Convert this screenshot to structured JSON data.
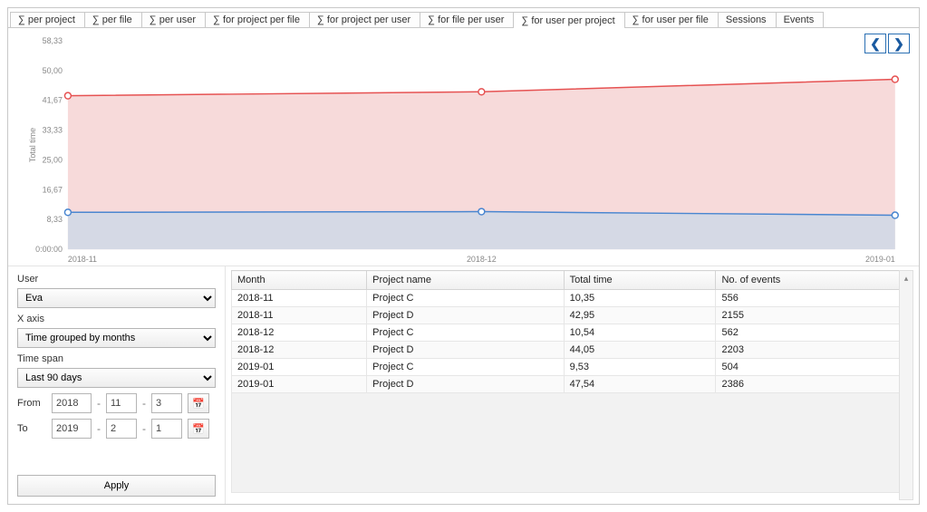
{
  "tabs": [
    "∑ per project",
    "∑ per file",
    "∑ per user",
    "∑ for project per file",
    "∑ for project per user",
    "∑ for file per user",
    "∑ for user per project",
    "∑ for user per file",
    "Sessions",
    "Events"
  ],
  "active_tab_index": 6,
  "chart_nav": {
    "prev": "❮",
    "next": "❯"
  },
  "chart_data": {
    "type": "area",
    "title": "",
    "xlabel": "",
    "ylabel": "Total time",
    "ylim": [
      0,
      58.33
    ],
    "yticks": [
      "0:00:00",
      "8,33",
      "16,67",
      "25,00",
      "33,33",
      "41,67",
      "50,00",
      "58,33"
    ],
    "x_categories": [
      "2018-11",
      "2018-12",
      "2019-01"
    ],
    "series": [
      {
        "name": "Project D",
        "color": "#e65252",
        "fill": "#f6d3d3",
        "values": [
          42.95,
          44.05,
          47.54
        ]
      },
      {
        "name": "Project C",
        "color": "#4a86d0",
        "fill": "#cfd8e6",
        "values": [
          10.35,
          10.54,
          9.53
        ]
      }
    ]
  },
  "filters": {
    "user_label": "User",
    "user_value": "Eva",
    "xaxis_label": "X axis",
    "xaxis_value": "Time grouped by months",
    "timespan_label": "Time span",
    "timespan_value": "Last 90 days",
    "from_label": "From",
    "to_label": "To",
    "from_date": {
      "y": "2018",
      "m": "11",
      "d": "3"
    },
    "to_date": {
      "y": "2019",
      "m": "2",
      "d": "1"
    },
    "apply_label": "Apply"
  },
  "table": {
    "columns": [
      "Month",
      "Project name",
      "Total time",
      "No. of events"
    ],
    "rows": [
      [
        "2018-11",
        "Project C",
        "10,35",
        "556"
      ],
      [
        "2018-11",
        "Project D",
        "42,95",
        "2155"
      ],
      [
        "2018-12",
        "Project C",
        "10,54",
        "562"
      ],
      [
        "2018-12",
        "Project D",
        "44,05",
        "2203"
      ],
      [
        "2019-01",
        "Project C",
        "9,53",
        "504"
      ],
      [
        "2019-01",
        "Project D",
        "47,54",
        "2386"
      ]
    ]
  }
}
